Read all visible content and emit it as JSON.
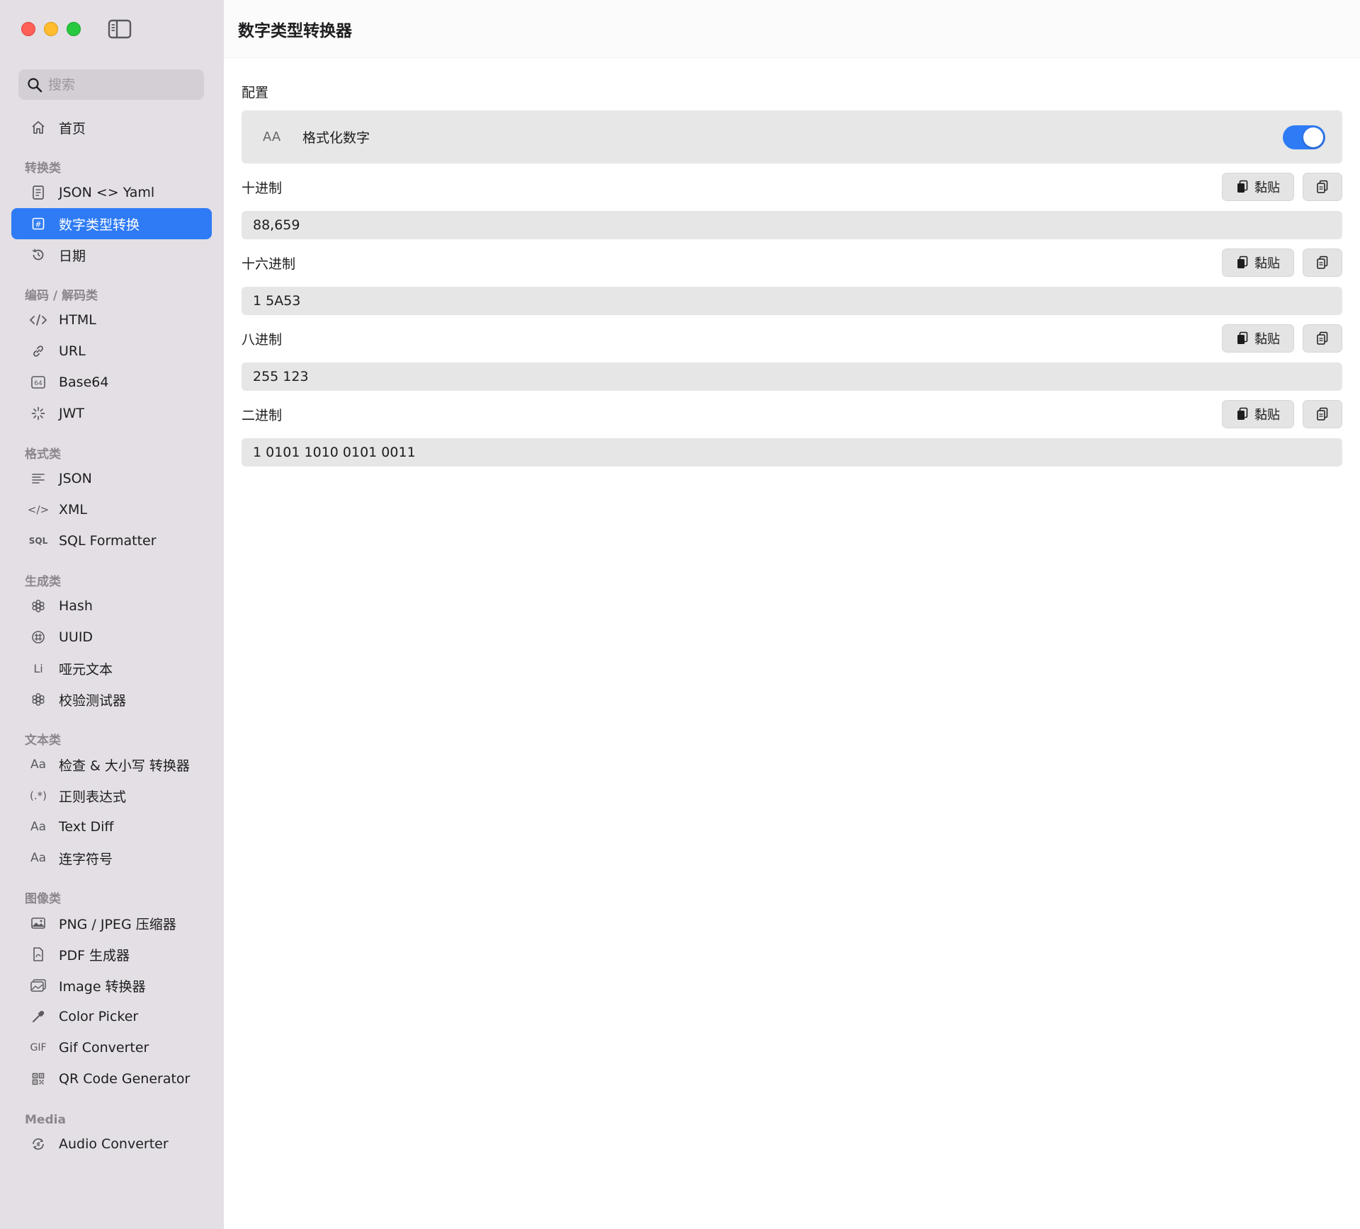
{
  "sidebar": {
    "search_placeholder": "搜索",
    "home": "首页",
    "sections": {
      "convert": "转换类",
      "codec": "编码 / 解码类",
      "format": "格式类",
      "generate": "生成类",
      "text": "文本类",
      "image": "图像类",
      "media": "Media"
    },
    "convert_items": {
      "json_yaml": "JSON <> Yaml",
      "number": "数字类型转换",
      "date": "日期"
    },
    "codec_items": {
      "html": "HTML",
      "url": "URL",
      "base64": "Base64",
      "jwt": "JWT"
    },
    "format_items": {
      "json": "JSON",
      "xml": "XML",
      "sql": "SQL Formatter"
    },
    "generate_items": {
      "hash": "Hash",
      "uuid": "UUID",
      "lorem": "哑元文本",
      "checksum": "校验测试器"
    },
    "text_items": {
      "inspect": "检查 & 大小写 转换器",
      "regex": "正则表达式",
      "diff": "Text Diff",
      "hyphen": "连字符号"
    },
    "image_items": {
      "compressor": "PNG / JPEG 压缩器",
      "pdf": "PDF 生成器",
      "image_conv": "Image 转换器",
      "color_picker": "Color Picker",
      "gif": "Gif Converter",
      "qr": "QR Code Generator"
    },
    "media_items": {
      "audio": "Audio Converter"
    },
    "icon_labels": {
      "base64": "64",
      "sql": "SQL",
      "lorem": "Li",
      "aa": "Aa",
      "regex": "(.*)",
      "gif": "GIF",
      "code": "</>"
    }
  },
  "main": {
    "title": "数字类型转换器",
    "config_label": "配置",
    "format_numbers_label": "格式化数字",
    "format_numbers_enabled": true,
    "aa_icon": "AA",
    "paste_label": "黏贴",
    "fields": {
      "decimal": {
        "label": "十进制",
        "value": "88,659"
      },
      "hex": {
        "label": "十六进制",
        "value": "1 5A53"
      },
      "octal": {
        "label": "八进制",
        "value": "255 123"
      },
      "binary": {
        "label": "二进制",
        "value": "1 0101 1010 0101 0011"
      }
    }
  },
  "colors": {
    "accent": "#2f7bf5",
    "sidebar_bg": "#e3dfe4"
  }
}
